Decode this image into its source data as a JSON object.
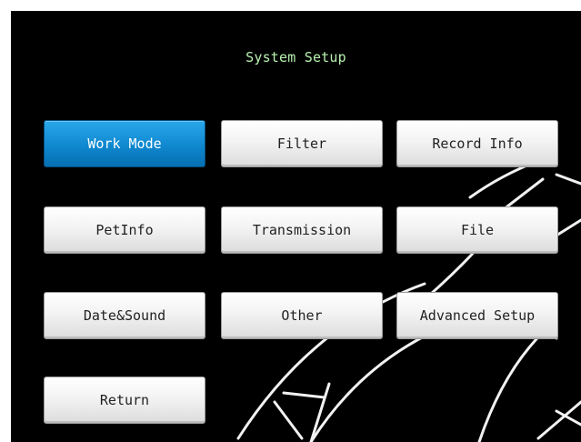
{
  "screen": {
    "title": "System Setup"
  },
  "colors": {
    "background": "#000000",
    "title_text": "#b8f0b0",
    "active_button": "#0f88cf",
    "button": "#f0f0f0"
  },
  "buttons": {
    "work_mode": {
      "label": "Work Mode",
      "selected": true
    },
    "filter": {
      "label": "Filter"
    },
    "record_info": {
      "label": "Record Info"
    },
    "pet_info": {
      "label": "PetInfo"
    },
    "transmission": {
      "label": "Transmission"
    },
    "file": {
      "label": "File"
    },
    "date_sound": {
      "label": "Date&Sound"
    },
    "other": {
      "label": "Other"
    },
    "advanced_setup": {
      "label": "Advanced Setup"
    },
    "return": {
      "label": "Return"
    }
  }
}
